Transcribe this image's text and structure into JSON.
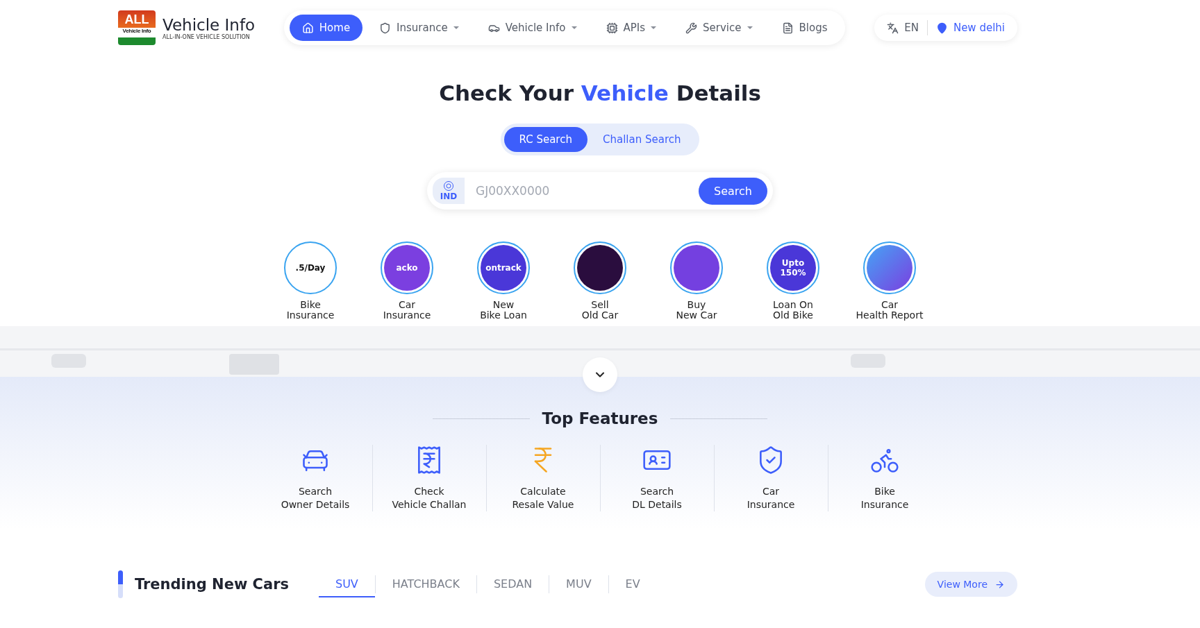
{
  "logo": {
    "badge_top": "ALL",
    "badge_bottom": "Vehicle Info",
    "name": "Vehicle Info",
    "tagline": "ALL-IN-ONE VEHICLE SOLUTION"
  },
  "nav": [
    {
      "label": "Home",
      "selected": true,
      "dropdown": false
    },
    {
      "label": "Insurance",
      "selected": false,
      "dropdown": true
    },
    {
      "label": "Vehicle Info",
      "selected": false,
      "dropdown": true
    },
    {
      "label": "APIs",
      "selected": false,
      "dropdown": true
    },
    {
      "label": "Service",
      "selected": false,
      "dropdown": true
    },
    {
      "label": "Blogs",
      "selected": false,
      "dropdown": false
    }
  ],
  "language": "EN",
  "location": "New delhi",
  "hero": {
    "title_before": "Check Your ",
    "title_highlight": "Vehicle",
    "title_after": " Details"
  },
  "search_tabs": [
    {
      "label": "RC Search",
      "selected": true
    },
    {
      "label": "Challan Search",
      "selected": false
    }
  ],
  "search": {
    "country": "IND",
    "placeholder": "GJ00XX0000",
    "button": "Search"
  },
  "services": [
    {
      "line1": "Bike",
      "line2": "Insurance",
      "promo": ".5/Day"
    },
    {
      "line1": "Car",
      "line2": "Insurance",
      "promo": "acko"
    },
    {
      "line1": "New",
      "line2": "Bike Loan",
      "promo": "ontrack"
    },
    {
      "line1": "Sell",
      "line2": "Old Car"
    },
    {
      "line1": "Buy",
      "line2": "New Car"
    },
    {
      "line1": "Loan On",
      "line2": "Old Bike",
      "promo": "Upto 150%"
    },
    {
      "line1": "Car",
      "line2": "Health Report"
    }
  ],
  "features_title": "Top Features",
  "features": [
    {
      "line1": "Search",
      "line2": "Owner Details"
    },
    {
      "line1": "Check",
      "line2": "Vehicle Challan"
    },
    {
      "line1": "Calculate",
      "line2": "Resale Value"
    },
    {
      "line1": "Search",
      "line2": "DL Details"
    },
    {
      "line1": "Car",
      "line2": "Insurance"
    },
    {
      "line1": "Bike",
      "line2": "Insurance"
    }
  ],
  "trending": {
    "title": "Trending New Cars",
    "tabs": [
      {
        "label": "SUV",
        "selected": true
      },
      {
        "label": "HATCHBACK",
        "selected": false
      },
      {
        "label": "SEDAN",
        "selected": false
      },
      {
        "label": "MUV",
        "selected": false
      },
      {
        "label": "EV",
        "selected": false
      }
    ],
    "view_more": "View More"
  }
}
